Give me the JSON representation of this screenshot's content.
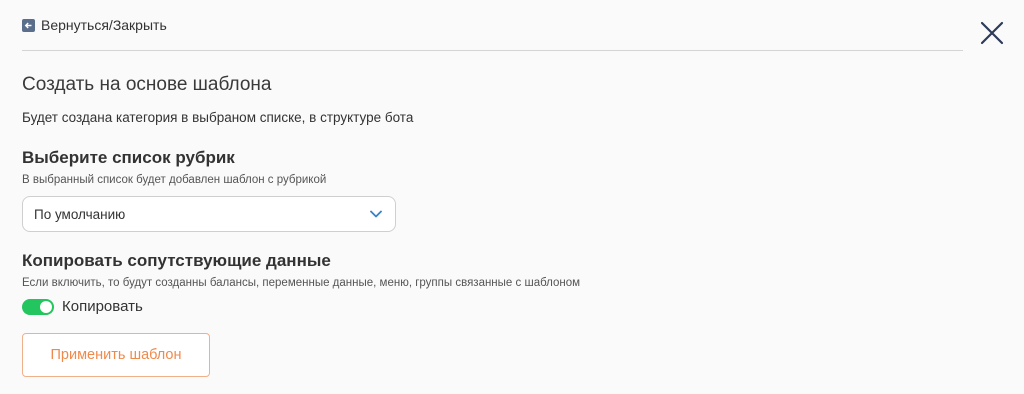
{
  "header": {
    "back_label": "Вернуться/Закрыть",
    "back_icon": "back-arrow-icon",
    "close_icon": "close-icon"
  },
  "main": {
    "title": "Создать на основе шаблона",
    "description": "Будет создана категория в выбраном списке, в структуре бота",
    "rubric_section": {
      "title": "Выберите список рубрик",
      "hint": "В выбранный список будет добавлен шаблон с рубрикой",
      "selected_value": "По умолчанию"
    },
    "copy_section": {
      "title": "Копировать сопутствующие данные",
      "hint": "Если включить, то будут созданны балансы, переменные данные, меню, группы связанные с шаблоном",
      "toggle_label": "Копировать",
      "toggle_on": true
    },
    "apply_label": "Применить шаблон"
  },
  "colors": {
    "accent_orange": "#f08a4b",
    "toggle_green": "#22c55e",
    "close_navy": "#2d3a5a"
  }
}
